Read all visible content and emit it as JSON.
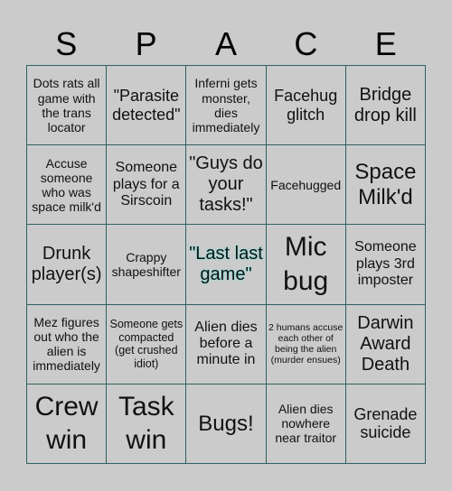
{
  "header": {
    "letters": [
      "S",
      "P",
      "A",
      "C",
      "E"
    ]
  },
  "colors": {
    "background": "#cbcbcb",
    "grid_line": "#2f6264",
    "free_glow": "#6fe7e0"
  },
  "cells": [
    "Dots rats all game with the trans locator",
    "\"Parasite detected\"",
    "Inferni gets monster, dies immediately",
    "Facehug glitch",
    "Bridge drop kill",
    "Accuse someone who was space milk'd",
    "Someone plays for a Sirscoin",
    "\"Guys do your tasks!\"",
    "Facehugged",
    "Space Milk'd",
    "Drunk player(s)",
    "Crappy shapeshifter",
    "\"Last last game\"",
    "Mic bug",
    "Someone plays 3rd imposter",
    "Mez figures out who the alien is immediately",
    "Someone gets compacted (get crushed idiot)",
    "Alien dies before a minute in",
    "2 humans accuse each other of being the alien (murder ensues)",
    "Darwin Award Death",
    "Crew win",
    "Task win",
    "Bugs!",
    "Alien dies nowhere near traitor",
    "Grenade suicide"
  ]
}
